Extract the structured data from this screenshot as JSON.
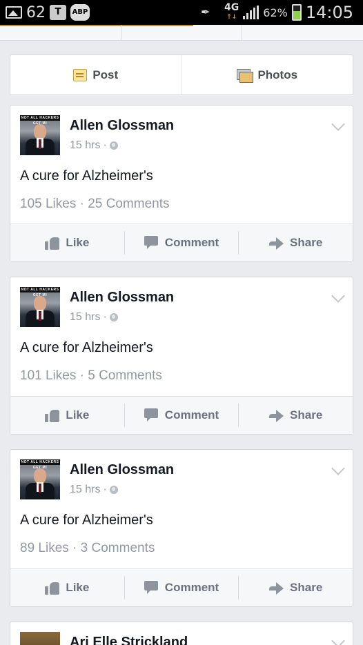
{
  "status_bar": {
    "notification_count": "62",
    "network": "4G",
    "battery": "62%",
    "time": "14:05",
    "icons": [
      "gallery-icon",
      "bag-icon",
      "adblock-icon",
      "mute-icon",
      "signal-icon",
      "battery-icon"
    ]
  },
  "composer": {
    "post_label": "Post",
    "photos_label": "Photos"
  },
  "posts": [
    {
      "author": "Allen Glossman",
      "time": "15 hrs",
      "separator": "·",
      "text": "A cure for Alzheimer's",
      "stats": "105 Likes · 25 Comments",
      "actions": {
        "like": "Like",
        "comment": "Comment",
        "share": "Share"
      }
    },
    {
      "author": "Allen Glossman",
      "time": "15 hrs",
      "separator": "·",
      "text": "A cure for Alzheimer's",
      "stats": "101 Likes · 5 Comments",
      "actions": {
        "like": "Like",
        "comment": "Comment",
        "share": "Share"
      }
    },
    {
      "author": "Allen Glossman",
      "time": "15 hrs",
      "separator": "·",
      "text": "A cure for Alzheimer's",
      "stats": "89 Likes · 3 Comments",
      "actions": {
        "like": "Like",
        "comment": "Comment",
        "share": "Share"
      }
    },
    {
      "author": "Ari Elle Strickland"
    }
  ],
  "avatar_banner": "NOT ALL HACKERS GET MI",
  "colors": {
    "background": "#e9ebee",
    "card": "#ffffff",
    "action_bar": "#f6f7f9",
    "muted_text": "#9197a3",
    "name_text": "#141823",
    "battery_fill": "#8fd14f"
  }
}
